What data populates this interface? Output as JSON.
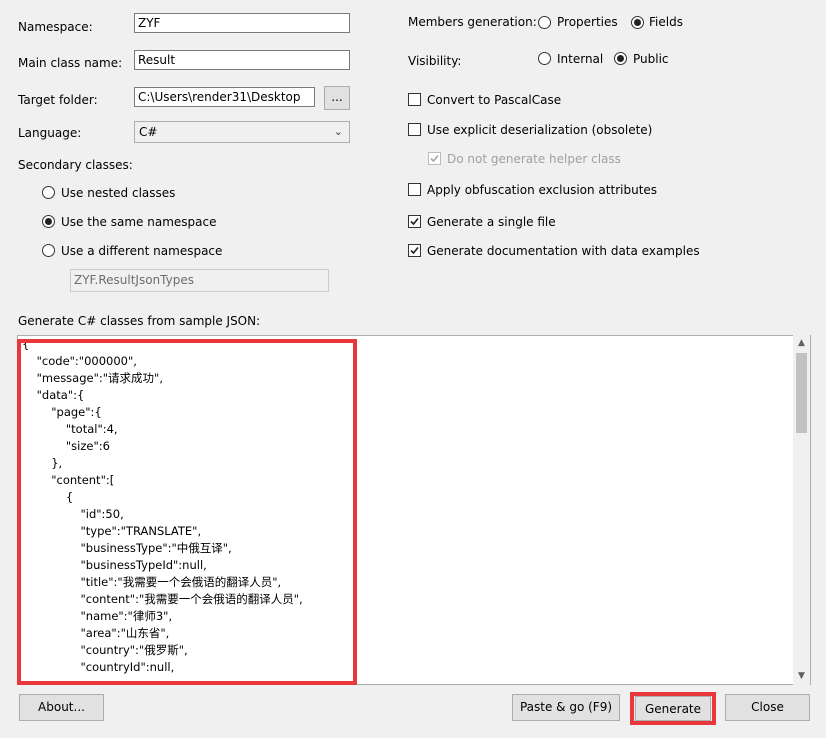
{
  "left": {
    "namespace_label": "Namespace:",
    "namespace_value": "ZYF",
    "mainclass_label": "Main class name:",
    "mainclass_value": "Result",
    "target_label": "Target folder:",
    "target_value": "C:\\Users\\render31\\Desktop",
    "browse_label": "...",
    "language_label": "Language:",
    "language_value": "C#",
    "secondary_label": "Secondary classes:",
    "opt_nested": "Use nested classes",
    "opt_same": "Use the same namespace",
    "opt_different": "Use a different namespace",
    "different_ns_value": "ZYF.ResultJsonTypes",
    "selected_secondary": "same"
  },
  "right": {
    "members_label": "Members generation:",
    "members_properties": "Properties",
    "members_fields": "Fields",
    "members_selected": "fields",
    "visibility_label": "Visibility:",
    "visibility_internal": "Internal",
    "visibility_public": "Public",
    "visibility_selected": "public",
    "convert_pascal": "Convert to PascalCase",
    "explicit_deser": "Use explicit deserialization (obsolete)",
    "no_helper": "Do not generate helper class",
    "obfuscation": "Apply obfuscation exclusion attributes",
    "single_file": "Generate a single file",
    "documentation": "Generate documentation with data examples"
  },
  "json": {
    "label": "Generate C# classes from sample JSON:",
    "lines": [
      "{",
      "    \"code\":\"000000\",",
      "    \"message\":\"请求成功\",",
      "    \"data\":{",
      "        \"page\":{",
      "            \"total\":4,",
      "            \"size\":6",
      "        },",
      "        \"content\":[",
      "            {",
      "                \"id\":50,",
      "                \"type\":\"TRANSLATE\",",
      "                \"businessType\":\"中俄互译\",",
      "                \"businessTypeId\":null,",
      "                \"title\":\"我需要一个会俄语的翻译人员\",",
      "                \"content\":\"我需要一个会俄语的翻译人员\",",
      "                \"name\":\"律师3\",",
      "                \"area\":\"山东省\",",
      "                \"country\":\"俄罗斯\",",
      "                \"countryId\":null,"
    ]
  },
  "buttons": {
    "about": "About...",
    "paste_go": "Paste & go (F9)",
    "generate": "Generate",
    "close": "Close"
  },
  "colors": {
    "highlight": "#e8383d",
    "background": "#f0f0f0"
  }
}
